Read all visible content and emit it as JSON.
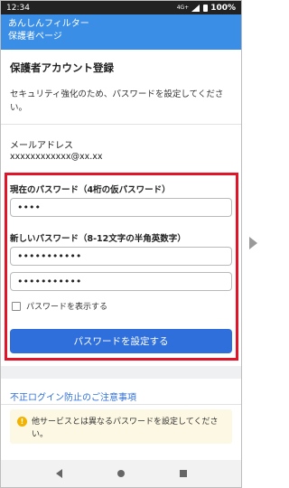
{
  "statusbar": {
    "time": "12:34",
    "network": "4G+",
    "battery": "100%"
  },
  "header": {
    "line1": "あんしんフィルター",
    "line2": "保護者ページ"
  },
  "account": {
    "title": "保護者アカウント登録",
    "description": "セキュリティ強化のため、パスワードを設定してください。"
  },
  "mail": {
    "label": "メールアドレス",
    "value": "xxxxxxxxxxxx@xx.xx"
  },
  "current_password": {
    "label": "現在のパスワード（4桁の仮パスワード）",
    "value": "••••"
  },
  "new_password": {
    "label": "新しいパスワード（8-12文字の半角英数字）",
    "value": "•••••••••••",
    "confirm_value": "•••••••••••"
  },
  "show_password": {
    "label": "パスワードを表示する",
    "checked": false
  },
  "submit": {
    "label": "パスワードを設定する"
  },
  "notice": {
    "title": "不正ログイン防止のご注意事項",
    "warning": "他サービスとは異なるパスワードを設定してください。"
  },
  "colors": {
    "header": "#3a8ee6",
    "button": "#2f6fdb",
    "highlight": "#e0152a",
    "warning_bg": "#fdf8e3"
  },
  "icons": {
    "warning": "exclamation-circle-icon",
    "next": "chevron-right-icon"
  }
}
